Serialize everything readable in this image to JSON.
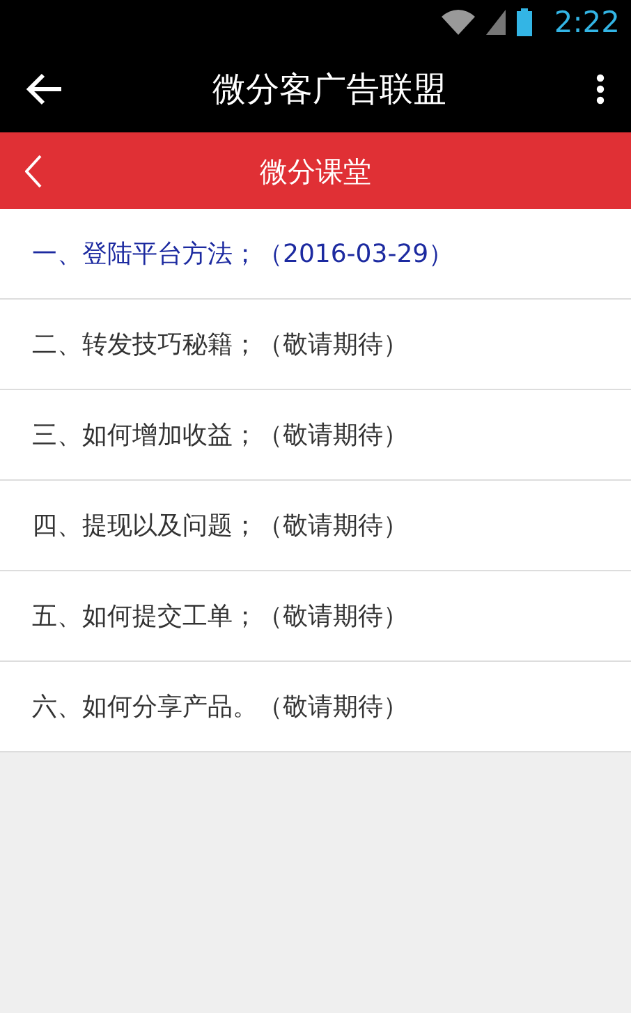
{
  "status_bar": {
    "time": "2:22"
  },
  "app_bar": {
    "title": "微分客广告联盟"
  },
  "header": {
    "title": "微分课堂"
  },
  "lessons": [
    {
      "label": "一、登陆平台方法；（2016-03-29）",
      "selected": true
    },
    {
      "label": "二、转发技巧秘籍；（敬请期待）",
      "selected": false
    },
    {
      "label": "三、如何增加收益；（敬请期待）",
      "selected": false
    },
    {
      "label": "四、提现以及问题；（敬请期待）",
      "selected": false
    },
    {
      "label": "五、如何提交工单；（敬请期待）",
      "selected": false
    },
    {
      "label": "六、如何分享产品。（敬请期待）",
      "selected": false
    }
  ]
}
